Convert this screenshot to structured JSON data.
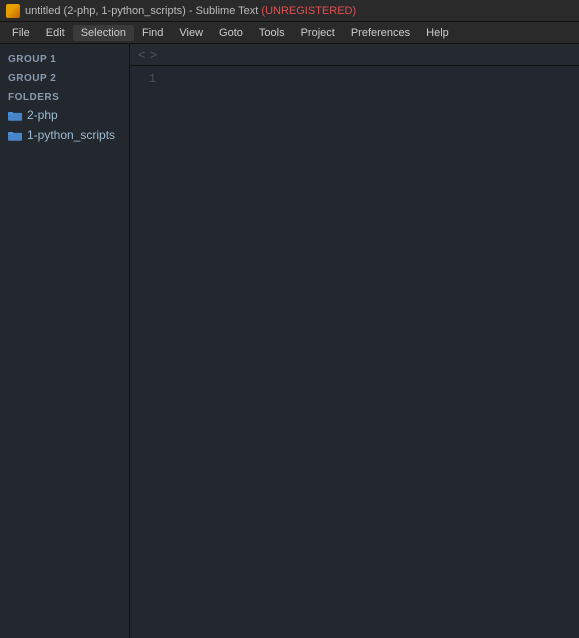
{
  "title_bar": {
    "title": "untitled (2-php, 1-python_scripts) - Sublime Text",
    "unregistered": "(UNREGISTERED)",
    "icon_label": "sublime-text-icon"
  },
  "menu_bar": {
    "items": [
      {
        "id": "file",
        "label": "File"
      },
      {
        "id": "edit",
        "label": "Edit"
      },
      {
        "id": "selection",
        "label": "Selection"
      },
      {
        "id": "find",
        "label": "Find"
      },
      {
        "id": "view",
        "label": "View"
      },
      {
        "id": "goto",
        "label": "Goto"
      },
      {
        "id": "tools",
        "label": "Tools"
      },
      {
        "id": "project",
        "label": "Project"
      },
      {
        "id": "preferences",
        "label": "Preferences"
      },
      {
        "id": "help",
        "label": "Help"
      }
    ]
  },
  "sidebar": {
    "group1_label": "GROUP 1",
    "group2_label": "GROUP 2",
    "folders_label": "FOLDERS",
    "folders": [
      {
        "id": "folder-php",
        "name": "2-php"
      },
      {
        "id": "folder-python",
        "name": "1-python_scripts"
      }
    ]
  },
  "editor": {
    "nav": {
      "back_label": "<",
      "forward_label": ">"
    },
    "line_numbers": [
      "1"
    ]
  }
}
